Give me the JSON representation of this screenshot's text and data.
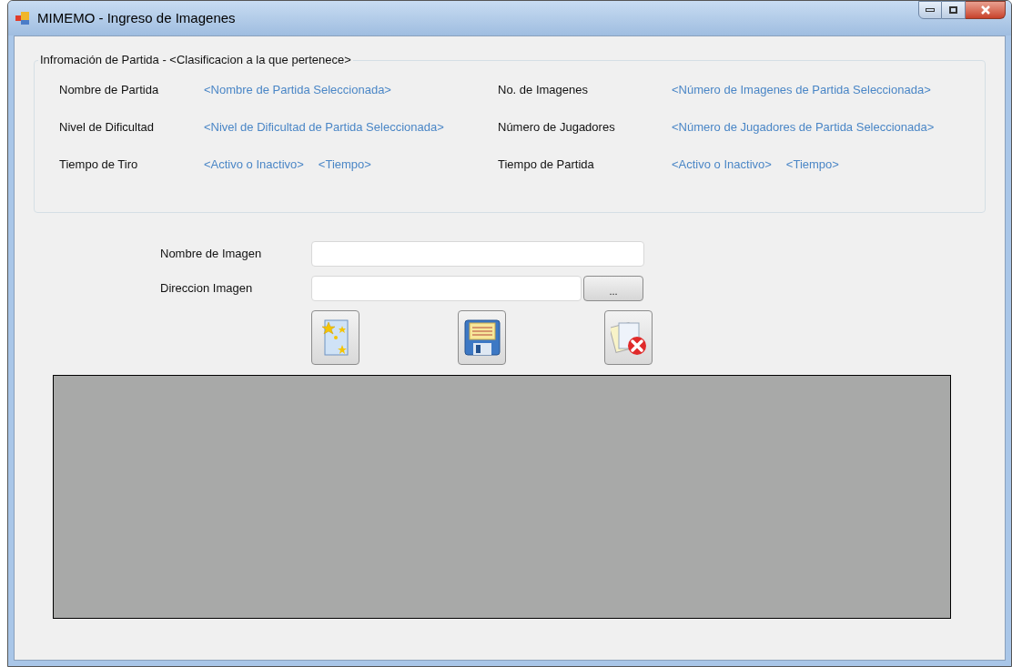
{
  "window": {
    "title": "MIMEMO - Ingreso de Imagenes"
  },
  "group": {
    "title": "Infromación de Partida - <Clasificacion a la que pertenece>",
    "rows": [
      {
        "label": "Nombre de Partida",
        "values": [
          "<Nombre de Partida Seleccionada>"
        ],
        "label2": "No. de Imagenes",
        "values2": [
          "<Número de Imagenes de Partida Seleccionada>"
        ]
      },
      {
        "label": "Nivel de Dificultad",
        "values": [
          "<Nivel de Dificultad de Partida Seleccionada>"
        ],
        "label2": "Número de Jugadores",
        "values2": [
          "<Número de Jugadores de Partida Seleccionada>"
        ]
      },
      {
        "label": "Tiempo de Tiro",
        "values": [
          "<Activo o Inactivo>",
          "<Tiempo>"
        ],
        "label2": "Tiempo de Partida",
        "values2": [
          "<Activo o Inactivo>",
          "<Tiempo>"
        ]
      }
    ]
  },
  "form": {
    "name_label": "Nombre de Imagen",
    "path_label": "Direccion Imagen",
    "browse_button": "..."
  },
  "actions": [
    {
      "kind": "new"
    },
    {
      "kind": "save"
    },
    {
      "kind": "delete"
    }
  ]
}
